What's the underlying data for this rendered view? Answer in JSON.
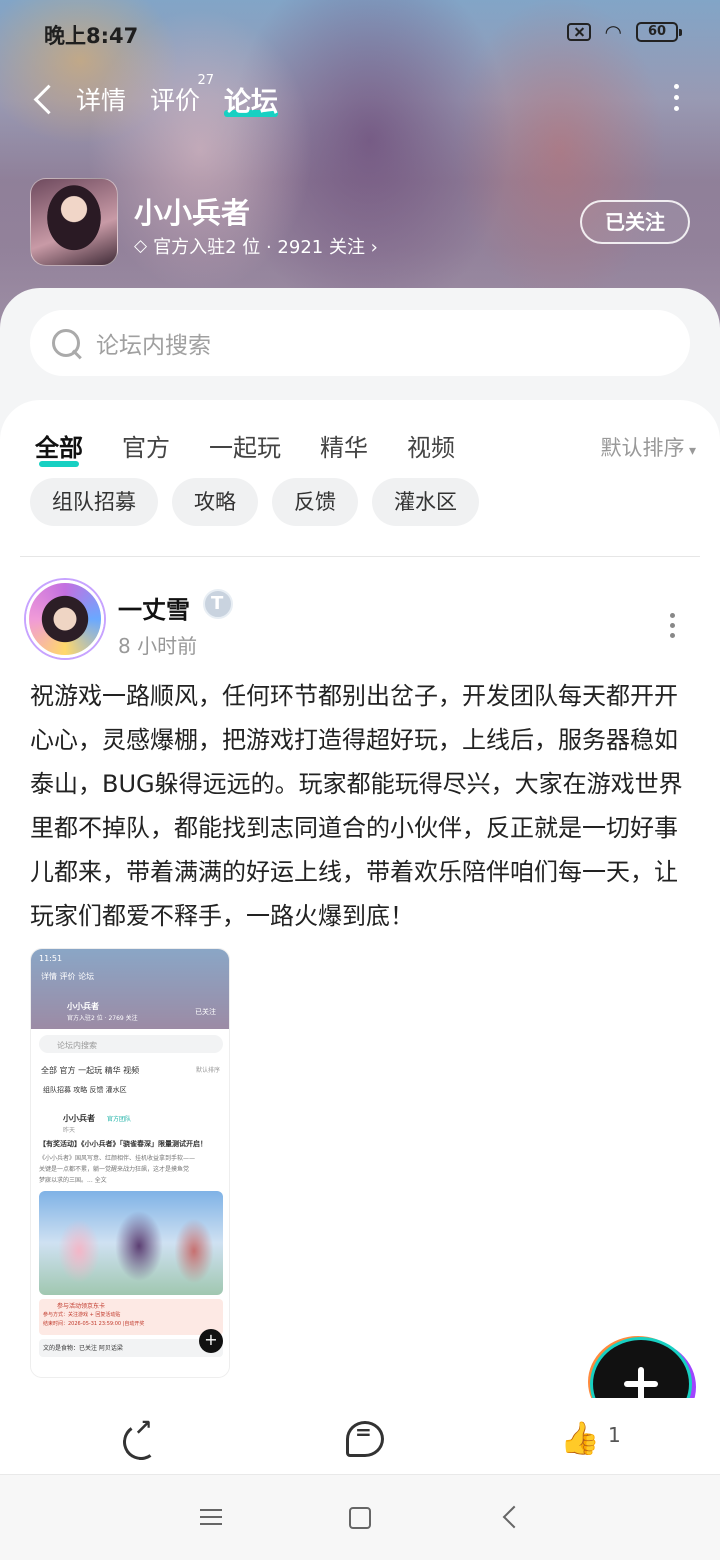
{
  "status": {
    "time": "晚上8:47",
    "battery": "60"
  },
  "nav": {
    "tabs": [
      {
        "label": "详情"
      },
      {
        "label": "评价",
        "badge": "27"
      },
      {
        "label": "论坛"
      }
    ]
  },
  "game": {
    "name": "小小兵者",
    "meta": "官方入驻2 位 · 2921 关注 ›",
    "follow_label": "已关注"
  },
  "search": {
    "placeholder": "论坛内搜索"
  },
  "filters": {
    "tabs": [
      "全部",
      "官方",
      "一起玩",
      "精华",
      "视频"
    ],
    "sort_label": "默认排序"
  },
  "chips": [
    "组队招募",
    "攻略",
    "反馈",
    "灌水区"
  ],
  "post": {
    "author": "一丈雪",
    "time": "8 小时前",
    "text": "祝游戏一路顺风，任何环节都别出岔子，开发团队每天都开开心心，灵感爆棚，把游戏打造得超好玩，上线后，服务器稳如泰山，BUG躲得远远的。玩家都能玩得尽兴，大家在游戏世界里都不掉队，都能找到志同道合的小伙伴，反正就是一切好事儿都来，带着满满的好运上线，带着欢乐陪伴咱们每一天，让玩家们都爱不释手，一路火爆到底！",
    "like_count": "1",
    "thumbnail": {
      "time": "11:51",
      "tabs": "详情  评价  论坛",
      "game_name": "小小兵者",
      "game_meta": "官方入驻2 位 · 2769 关注",
      "follow": "已关注",
      "search": "论坛内搜索",
      "filter_tabs": "全部  官方  一起玩  精华  视频",
      "sort": "默认排序",
      "chips": "组队招募  攻略  反馈  灌水区",
      "post_author": "小小兵者",
      "post_badge": "官方团队",
      "post_time": "昨天",
      "post_title": "【有奖活动】《小小兵者》「骁雀春深」限量测试开启！",
      "post_body_1": "《小小兵者》国风写意、红颜相伴、挂机收益拿到手软——",
      "post_body_2": "关键是一点都不累，躺一觉醒来战力狂飙，这才是摸鱼党",
      "post_body_3": "梦寐以求的三国。... 全文",
      "promo_title": "参与活动领京东卡",
      "promo_line_1": "参与方式：关注游戏 + 回复活动贴",
      "promo_line_2": "结束时间：2026-05-31 23:59:00 |自动开奖",
      "footer": "文的是食物：已关注  阿贝话梁"
    }
  },
  "colors": {
    "accent": "#17d0c2"
  }
}
